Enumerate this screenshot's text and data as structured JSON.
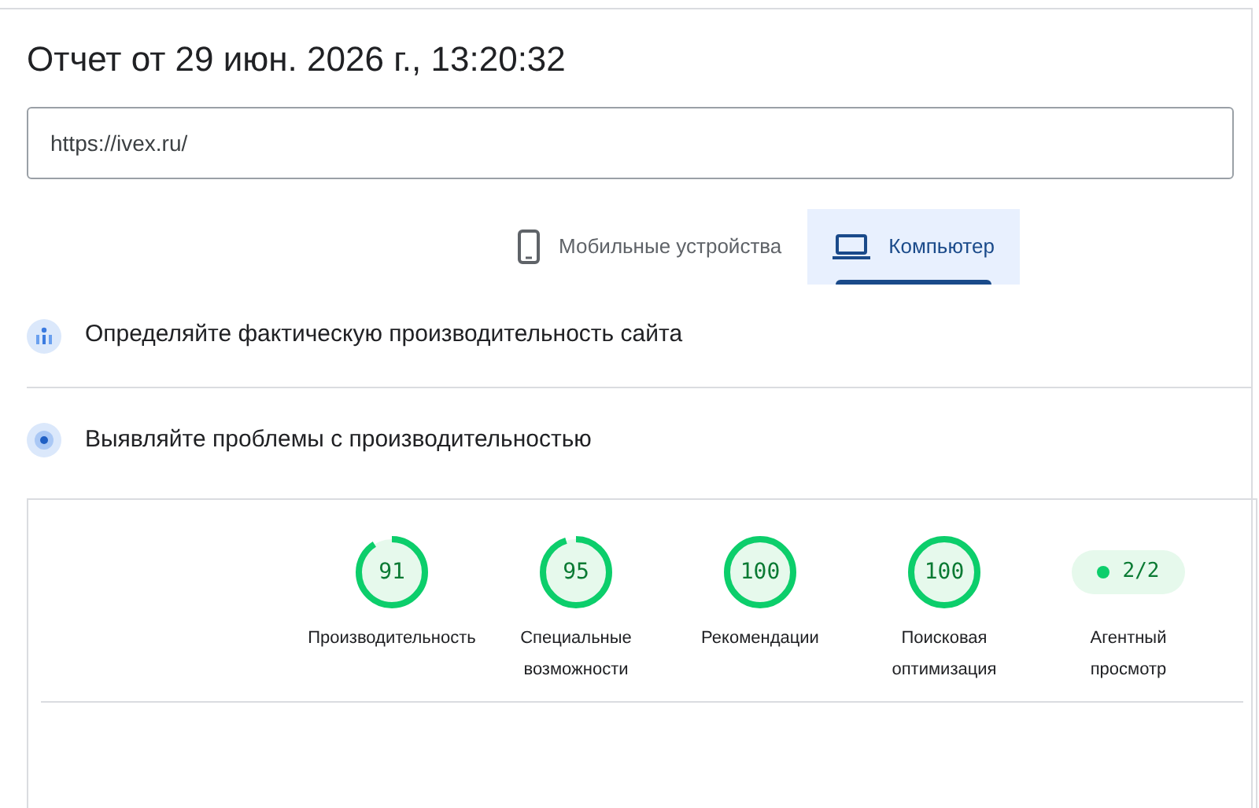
{
  "title": "Отчет от 29 июн. 2026 г., 13:20:32",
  "url_field": {
    "value": "https://ivex.ru/"
  },
  "tabs": [
    {
      "label": "Мобильные устройства",
      "kind": "mobile",
      "selected": false
    },
    {
      "label": "Компьютер",
      "kind": "desktop",
      "selected": true
    }
  ],
  "sections": [
    {
      "kind": "field",
      "label": "Определяйте фактическую производительность сайта"
    },
    {
      "kind": "lab",
      "label": "Выявляйте проблемы с производительностью"
    }
  ],
  "scores": [
    {
      "kind": "gauge",
      "value": "91",
      "label": "Производительность"
    },
    {
      "kind": "gauge",
      "value": "95",
      "label": "Специальные возможности"
    },
    {
      "kind": "gauge",
      "value": "100",
      "label": "Рекомендации"
    },
    {
      "kind": "gauge",
      "value": "100",
      "label": "Поисковая оптимизация"
    },
    {
      "kind": "badge",
      "value": "2/2",
      "label": "Агентный просмотр"
    }
  ]
}
